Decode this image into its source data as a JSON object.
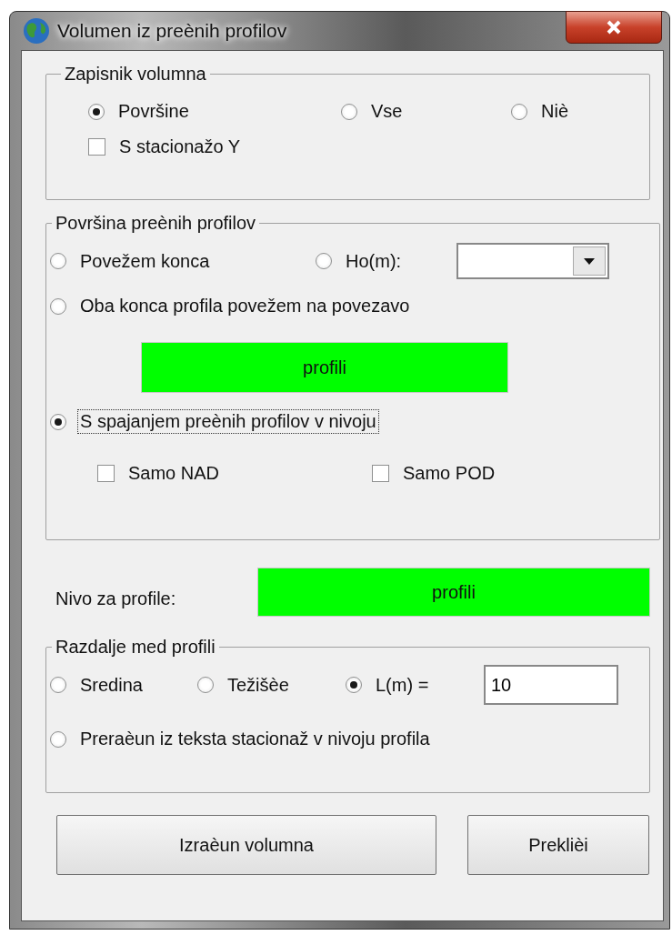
{
  "window": {
    "title": "Volumen iz preènih profilov"
  },
  "log_group": {
    "title": "Zapisnik volumna",
    "options": [
      {
        "label": "Površine",
        "selected": true
      },
      {
        "label": "Vse",
        "selected": false
      },
      {
        "label": "Niè",
        "selected": false
      }
    ],
    "station_checkbox": {
      "label": "S stacionažo Y",
      "checked": false
    }
  },
  "surface_group": {
    "title": "Površina preènih profilov",
    "connect_ends": {
      "label": "Povežem konca",
      "selected": false
    },
    "height_option": {
      "label": "Ho(m):",
      "selected": false
    },
    "both_ends": {
      "label": "Oba konca profila povežem na povezavo",
      "selected": false
    },
    "layer_button": {
      "label": "profili"
    },
    "merge_option": {
      "label": "S spajanjem preènih profilov v nivoju",
      "selected": true,
      "focused": true
    },
    "checkboxes": [
      {
        "label": "Samo NAD",
        "checked": false
      },
      {
        "label": "Samo POD",
        "checked": false
      }
    ]
  },
  "level_row": {
    "label": "Nivo za profile:",
    "button": "profili"
  },
  "distance_group": {
    "title": "Razdalje med profili",
    "options": [
      {
        "label": "Sredina",
        "selected": false
      },
      {
        "label": "Težišèe",
        "selected": false
      },
      {
        "label": "L(m) =",
        "selected": true
      }
    ],
    "length_value": "10",
    "text_option": {
      "label": "Preraèun iz teksta stacionaž v nivoju profila",
      "selected": false
    }
  },
  "buttons": [
    {
      "label": "Izraèun volumna"
    },
    {
      "label": "Preklièi"
    }
  ]
}
